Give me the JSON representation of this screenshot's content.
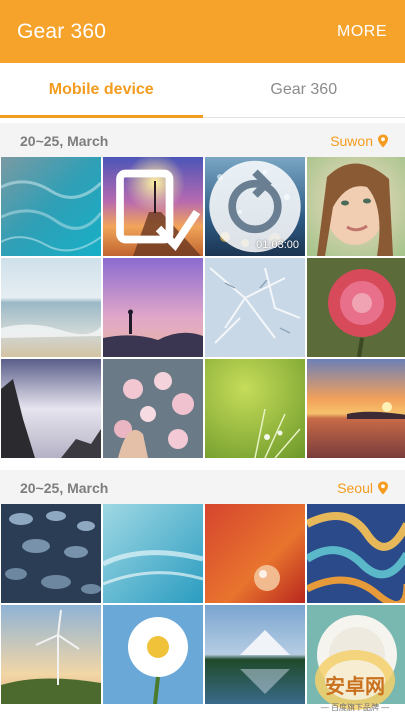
{
  "appbar": {
    "title": "Gear 360",
    "more_label": "MORE"
  },
  "tabs": [
    {
      "label": "Mobile device",
      "active": true
    },
    {
      "label": "Gear 360",
      "active": false
    }
  ],
  "sections": [
    {
      "date": "20~25, March",
      "location": "Suwon"
    },
    {
      "date": "20~25, March",
      "location": "Seoul"
    }
  ],
  "video": {
    "duration": "01:03:00"
  },
  "watermark": {
    "main": "安卓网",
    "sub": "— 百度旗下品牌 —"
  },
  "colors": {
    "accent": "#f6a32c",
    "accent_text": "#f39c1f",
    "header_bg": "#f4f4f4"
  }
}
